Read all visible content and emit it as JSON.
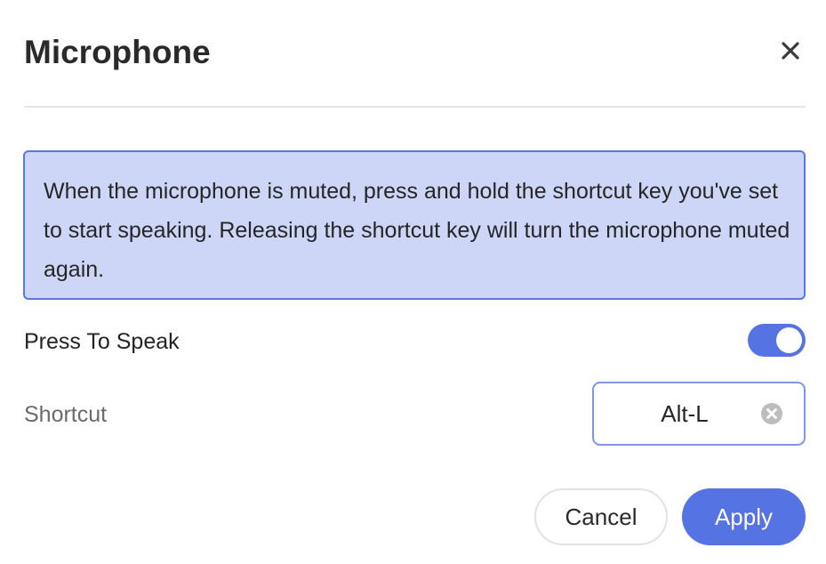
{
  "dialog": {
    "title": "Microphone",
    "close_icon": "close-icon"
  },
  "info": {
    "text": "When the microphone is muted, press and hold the shortcut key you've set to start speaking. Releasing the shortcut key will turn the microphone muted again."
  },
  "press_to_speak": {
    "label": "Press To Speak",
    "enabled": true
  },
  "shortcut": {
    "label": "Shortcut",
    "value": "Alt-L",
    "clear_icon": "clear-circle-icon"
  },
  "actions": {
    "cancel_label": "Cancel",
    "apply_label": "Apply"
  },
  "colors": {
    "accent": "#5673e3",
    "info_background": "#cdd6f6",
    "info_border": "#5a78e0"
  }
}
